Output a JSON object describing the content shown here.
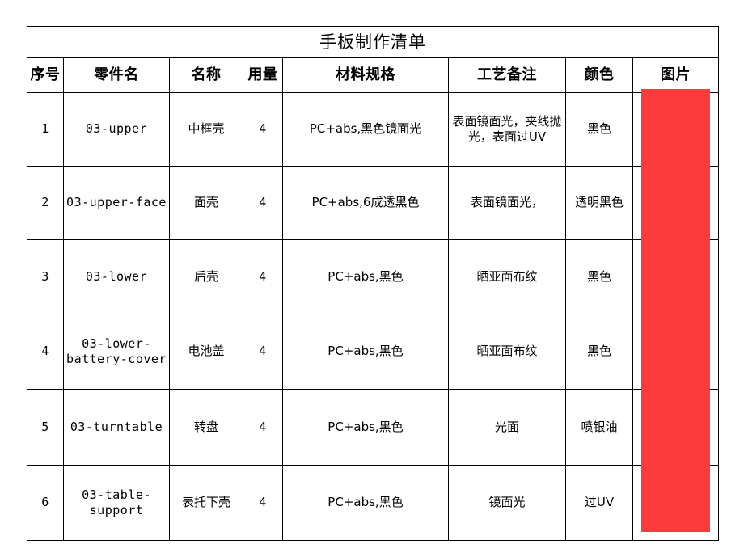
{
  "document": {
    "title": "手板制作清单"
  },
  "table": {
    "columns": [
      {
        "key": "seq",
        "label": "序号"
      },
      {
        "key": "part",
        "label": "零件名"
      },
      {
        "key": "name",
        "label": "名称"
      },
      {
        "key": "qty",
        "label": "用量"
      },
      {
        "key": "spec",
        "label": "材料规格"
      },
      {
        "key": "proc",
        "label": "工艺备注"
      },
      {
        "key": "color",
        "label": "颜色"
      },
      {
        "key": "image",
        "label": "图片"
      }
    ],
    "rows": [
      {
        "seq": "1",
        "part": "03-upper",
        "name": "中框壳",
        "qty": "4",
        "spec": "PC+abs,黑色镜面光",
        "proc": "表面镜面光，夹线抛光，表面过UV",
        "color": "黑色",
        "image": ""
      },
      {
        "seq": "2",
        "part": "03-upper-face",
        "name": "面壳",
        "qty": "4",
        "spec": "PC+abs,6成透黑色",
        "proc": "表面镜面光，",
        "color": "透明黑色",
        "image": ""
      },
      {
        "seq": "3",
        "part": "03-lower",
        "name": "后壳",
        "qty": "4",
        "spec": "PC+abs,黑色",
        "proc": "晒亚面布纹",
        "color": "黑色",
        "image": ""
      },
      {
        "seq": "4",
        "part": "03-lower-battery-cover",
        "name": "电池盖",
        "qty": "4",
        "spec": "PC+abs,黑色",
        "proc": "晒亚面布纹",
        "color": "黑色",
        "image": ""
      },
      {
        "seq": "5",
        "part": "03-turntable",
        "name": "转盘",
        "qty": "4",
        "spec": "PC+abs,黑色",
        "proc": "光面",
        "color": "喷银油",
        "image": ""
      },
      {
        "seq": "6",
        "part": "03-table-support",
        "name": "表托下壳",
        "qty": "4",
        "spec": "PC+abs,黑色",
        "proc": "镜面光",
        "color": "过UV",
        "image": ""
      }
    ]
  },
  "image_placeholder": {
    "color": "#f93b3b",
    "label": ""
  }
}
